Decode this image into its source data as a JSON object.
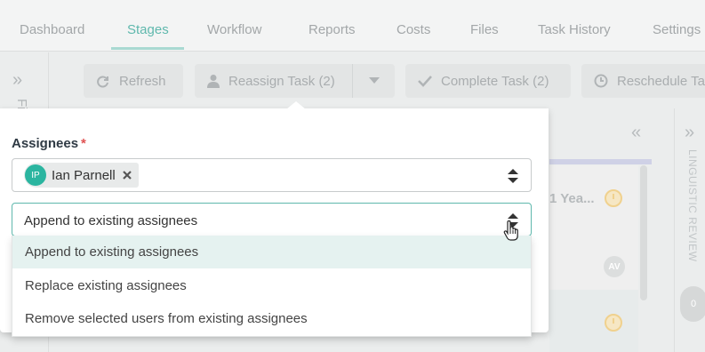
{
  "nav": {
    "tabs": [
      {
        "label": "Dashboard"
      },
      {
        "label": "Stages"
      },
      {
        "label": "Workflow"
      },
      {
        "label": "Reports"
      },
      {
        "label": "Costs"
      },
      {
        "label": "Files"
      },
      {
        "label": "Task History"
      },
      {
        "label": "Settings"
      }
    ],
    "active_tab": "Stages"
  },
  "left_panel": {
    "label": "Fi"
  },
  "toolbar": {
    "refresh_label": "Refresh",
    "reassign_label": "Reassign Task (2)",
    "complete_label": "Complete Task (2)",
    "reschedule_label": "Reschedule Ta"
  },
  "board": {
    "card_text": "1 Yea...",
    "avatar_initials": "AV",
    "right_column_label": "LINGUISTIC REVIEW",
    "right_column_count": "0"
  },
  "popover": {
    "assignees_label": "Assignees",
    "required_mark": "*",
    "assignee": {
      "initials": "IP",
      "name": "Ian Parnell"
    },
    "mode_selected": "Append to existing assignees",
    "options": [
      "Append to existing assignees",
      "Replace existing assignees",
      "Remove selected users from existing assignees"
    ]
  },
  "colors": {
    "accent": "#5fb8ad",
    "avatar": "#2bb5a0",
    "required": "#e05252",
    "selected_option_bg": "#e5f2f0"
  }
}
